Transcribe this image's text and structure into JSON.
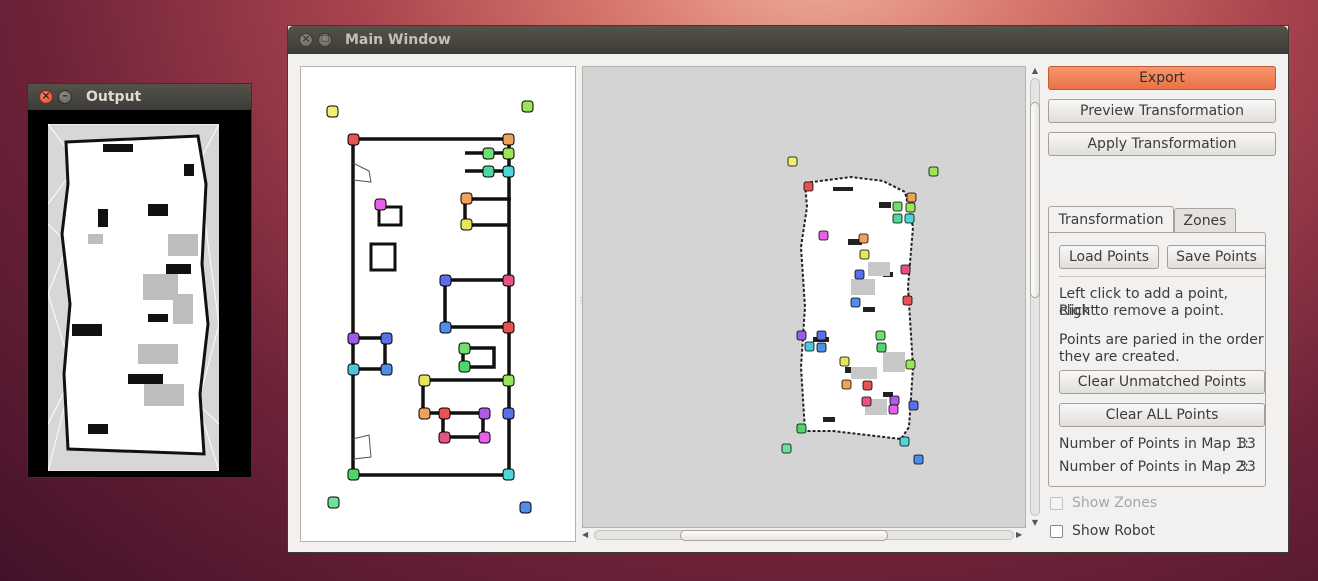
{
  "output_window": {
    "title": "Output"
  },
  "main_window": {
    "title": "Main Window",
    "buttons": {
      "export": "Export",
      "preview": "Preview Transformation",
      "apply": "Apply Transformation"
    },
    "tabs": [
      {
        "label": "Transformation",
        "active": true
      },
      {
        "label": "Zones",
        "active": false
      }
    ],
    "transformation_tab": {
      "load_points": "Load Points",
      "save_points": "Save Points",
      "instructions_line1": "Left click to add a point, Right",
      "instructions_line2": "click to remove a point.",
      "pairing_line1": "Points are paried in the order",
      "pairing_line2": "they are created.",
      "clear_unmatched": "Clear Unmatched Points",
      "clear_all": "Clear ALL Points",
      "map1_label": "Number of Points in Map 1:",
      "map1_count": "33",
      "map2_label": "Number of Points in Map 2:",
      "map2_count": "33"
    },
    "show_zones": {
      "label": "Show Zones",
      "checked": false,
      "enabled": false
    },
    "show_robot": {
      "label": "Show Robot",
      "checked": false,
      "enabled": true
    }
  },
  "colors": {
    "accent": "#ea7248",
    "titlebar": "#3c3b37",
    "window_bg": "#f2f1f0"
  }
}
